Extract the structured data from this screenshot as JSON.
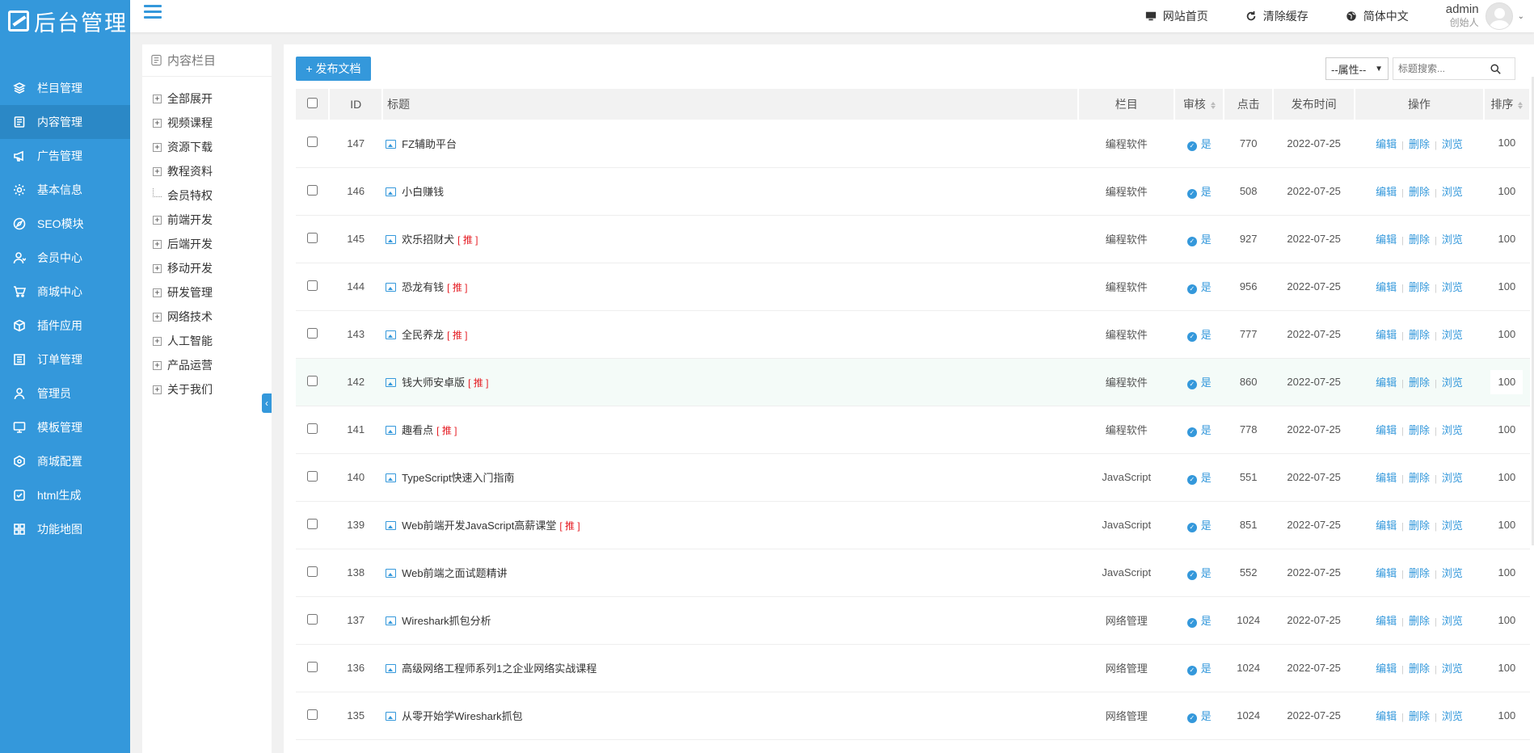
{
  "app": {
    "logo_text": "后台管理"
  },
  "sidebar": {
    "items": [
      {
        "label": "栏目管理",
        "icon": "layers-icon"
      },
      {
        "label": "内容管理",
        "icon": "document-icon",
        "active": true
      },
      {
        "label": "广告管理",
        "icon": "megaphone-icon"
      },
      {
        "label": "基本信息",
        "icon": "gear-icon"
      },
      {
        "label": "SEO模块",
        "icon": "compass-icon"
      },
      {
        "label": "会员中心",
        "icon": "user-icon"
      },
      {
        "label": "商城中心",
        "icon": "cart-icon"
      },
      {
        "label": "插件应用",
        "icon": "cube-icon"
      },
      {
        "label": "订单管理",
        "icon": "list-icon"
      },
      {
        "label": "管理员",
        "icon": "person-icon"
      },
      {
        "label": "模板管理",
        "icon": "monitor-icon"
      },
      {
        "label": "商城配置",
        "icon": "hexagon-icon"
      },
      {
        "label": "html生成",
        "icon": "check-square-icon"
      },
      {
        "label": "功能地图",
        "icon": "grid-icon"
      }
    ]
  },
  "topbar": {
    "links": [
      {
        "label": "网站首页",
        "icon": "monitor-icon"
      },
      {
        "label": "清除缓存",
        "icon": "refresh-icon"
      },
      {
        "label": "简体中文",
        "icon": "globe-icon"
      }
    ],
    "user": {
      "name": "admin",
      "role": "创始人"
    }
  },
  "category": {
    "title": "内容栏目",
    "items": [
      {
        "label": "全部展开",
        "type": "plus"
      },
      {
        "label": "视频课程",
        "type": "plus"
      },
      {
        "label": "资源下载",
        "type": "plus"
      },
      {
        "label": "教程资料",
        "type": "plus"
      },
      {
        "label": "会员特权",
        "type": "leaf"
      },
      {
        "label": "前端开发",
        "type": "plus"
      },
      {
        "label": "后端开发",
        "type": "plus"
      },
      {
        "label": "移动开发",
        "type": "plus"
      },
      {
        "label": "研发管理",
        "type": "plus"
      },
      {
        "label": "网络技术",
        "type": "plus"
      },
      {
        "label": "人工智能",
        "type": "plus"
      },
      {
        "label": "产品运营",
        "type": "plus"
      },
      {
        "label": "关于我们",
        "type": "plus"
      }
    ]
  },
  "toolbar": {
    "publish_label": "+ 发布文档",
    "attr_select": "--属性--",
    "search_placeholder": "标题搜索..."
  },
  "table": {
    "headers": {
      "id": "ID",
      "title": "标题",
      "column": "栏目",
      "audit": "审核",
      "clicks": "点击",
      "date": "发布时间",
      "ops": "操作",
      "sort": "排序"
    },
    "op_labels": {
      "edit": "编辑",
      "delete": "删除",
      "view": "浏览"
    },
    "tui_label": "[ 推 ]",
    "rows": [
      {
        "id": "147",
        "title": "FZ辅助平台",
        "tui": false,
        "column": "编程软件",
        "audit": "是",
        "clicks": "770",
        "date": "2022-07-25",
        "sort": "100"
      },
      {
        "id": "146",
        "title": "小白赚钱",
        "tui": false,
        "column": "编程软件",
        "audit": "是",
        "clicks": "508",
        "date": "2022-07-25",
        "sort": "100"
      },
      {
        "id": "145",
        "title": "欢乐招财犬",
        "tui": true,
        "column": "编程软件",
        "audit": "是",
        "clicks": "927",
        "date": "2022-07-25",
        "sort": "100"
      },
      {
        "id": "144",
        "title": "恐龙有钱",
        "tui": true,
        "column": "编程软件",
        "audit": "是",
        "clicks": "956",
        "date": "2022-07-25",
        "sort": "100"
      },
      {
        "id": "143",
        "title": "全民养龙",
        "tui": true,
        "column": "编程软件",
        "audit": "是",
        "clicks": "777",
        "date": "2022-07-25",
        "sort": "100"
      },
      {
        "id": "142",
        "title": "钱大师安卓版",
        "tui": true,
        "column": "编程软件",
        "audit": "是",
        "clicks": "860",
        "date": "2022-07-25",
        "sort": "100",
        "highlight": true
      },
      {
        "id": "141",
        "title": "趣看点",
        "tui": true,
        "column": "编程软件",
        "audit": "是",
        "clicks": "778",
        "date": "2022-07-25",
        "sort": "100"
      },
      {
        "id": "140",
        "title": "TypeScript快速入门指南",
        "tui": false,
        "column": "JavaScript",
        "audit": "是",
        "clicks": "551",
        "date": "2022-07-25",
        "sort": "100"
      },
      {
        "id": "139",
        "title": "Web前端开发JavaScript高薪课堂",
        "tui": true,
        "column": "JavaScript",
        "audit": "是",
        "clicks": "851",
        "date": "2022-07-25",
        "sort": "100"
      },
      {
        "id": "138",
        "title": "Web前端之面试题精讲",
        "tui": false,
        "column": "JavaScript",
        "audit": "是",
        "clicks": "552",
        "date": "2022-07-25",
        "sort": "100"
      },
      {
        "id": "137",
        "title": "Wireshark抓包分析",
        "tui": false,
        "column": "网络管理",
        "audit": "是",
        "clicks": "1024",
        "date": "2022-07-25",
        "sort": "100"
      },
      {
        "id": "136",
        "title": "高级网络工程师系列1之企业网络实战课程",
        "tui": false,
        "column": "网络管理",
        "audit": "是",
        "clicks": "1024",
        "date": "2022-07-25",
        "sort": "100"
      },
      {
        "id": "135",
        "title": "从零开始学Wireshark抓包",
        "tui": false,
        "column": "网络管理",
        "audit": "是",
        "clicks": "1024",
        "date": "2022-07-25",
        "sort": "100"
      }
    ]
  },
  "colors": {
    "primary": "#3498db",
    "active": "#2b88c6",
    "tui": "#e51c23"
  }
}
